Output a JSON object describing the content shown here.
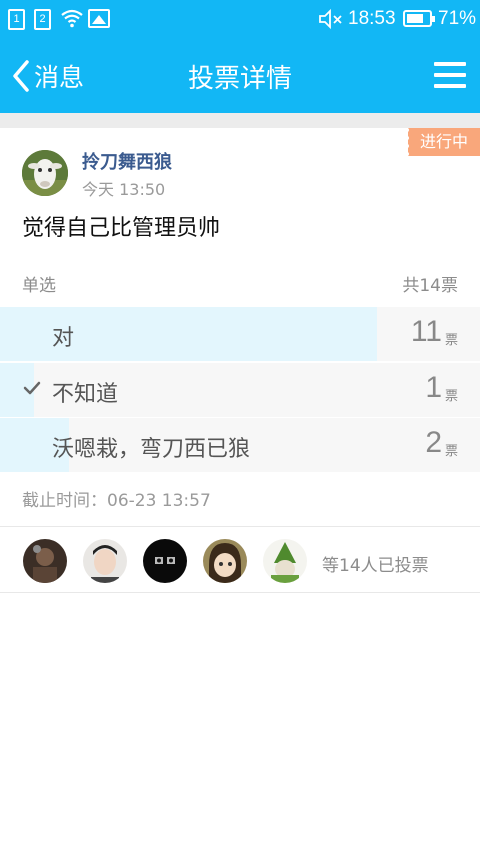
{
  "status_bar": {
    "sim1": "1",
    "sim2": "2",
    "time": "18:53",
    "battery": "71%",
    "icons": [
      "sim1-icon",
      "sim2-icon",
      "wifi-icon",
      "photo-icon",
      "mute-icon",
      "battery-icon"
    ]
  },
  "nav": {
    "back_label": "消息",
    "title": "投票详情",
    "menu_icon": "menu-icon"
  },
  "post": {
    "status_badge": "进行中",
    "author": "拎刀舞西狼",
    "time": "今天 13:50",
    "question": "觉得自己比管理员帅"
  },
  "vote": {
    "type": "单选",
    "total": "共14票",
    "unit": "票",
    "options": [
      {
        "label": "对",
        "count": "11",
        "fraction": 0.786,
        "selected": false
      },
      {
        "label": "不知道",
        "count": "1",
        "fraction": 0.071,
        "selected": true
      },
      {
        "label": "沃嗯栽，弯刀西已狼",
        "count": "2",
        "fraction": 0.143,
        "selected": false
      }
    ],
    "deadline": "截止时间：06-23 13:57"
  },
  "voters": {
    "summary": "等14人已投票",
    "count_shown": 5
  },
  "colors": {
    "primary": "#12b7f5",
    "badge": "#f9a77b",
    "option_fill": "#e3f6fd",
    "author": "#3b5b8f"
  }
}
